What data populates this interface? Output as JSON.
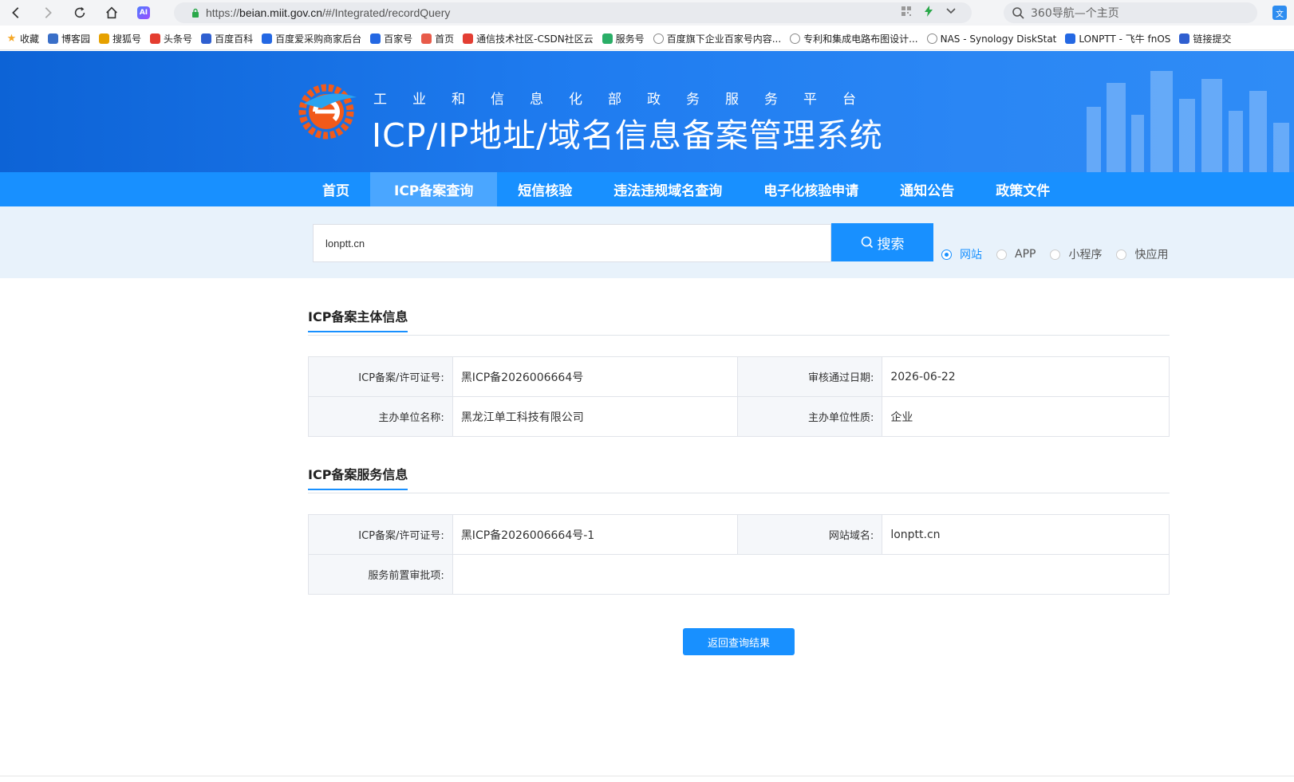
{
  "browser": {
    "url_scheme": "https://",
    "url_host": "beian.miit.gov.cn",
    "url_path": "/#/Integrated/recordQuery",
    "search_placeholder": "360导航—个主页",
    "ai_label": "AI"
  },
  "bookmarks": [
    {
      "label": "收藏",
      "icon": "star-icon",
      "color": "#f5a623"
    },
    {
      "label": "博客园",
      "icon": "cnblogs-icon",
      "color": "#3a6fc8"
    },
    {
      "label": "搜狐号",
      "icon": "sohu-icon",
      "color": "#e6a100"
    },
    {
      "label": "头条号",
      "icon": "toutiao-icon",
      "color": "#e43d30"
    },
    {
      "label": "百度百科",
      "icon": "baidu-paw-icon",
      "color": "#2f5fd0"
    },
    {
      "label": "百度爱采购商家后台",
      "icon": "caigou-icon",
      "color": "#2468e3"
    },
    {
      "label": "百家号",
      "icon": "baijiahao-icon",
      "color": "#2468e3"
    },
    {
      "label": "首页",
      "icon": "home-favicon",
      "color": "#e85b4a"
    },
    {
      "label": "通信技术社区-CSDN社区云",
      "icon": "csdn-icon",
      "color": "#e33e33"
    },
    {
      "label": "服务号",
      "icon": "wechat-icon",
      "color": "#2aae67"
    },
    {
      "label": "百度旗下企业百家号内容...",
      "icon": "globe-icon",
      "color": "#888888"
    },
    {
      "label": "专利和集成电路布图设计...",
      "icon": "globe-icon",
      "color": "#888888"
    },
    {
      "label": "NAS - Synology DiskStat",
      "icon": "globe-icon",
      "color": "#888888"
    },
    {
      "label": "LONPTT - 飞牛 fnOS",
      "icon": "fnos-icon",
      "color": "#2468e3"
    },
    {
      "label": "链接提交",
      "icon": "baidu-paw-icon",
      "color": "#2f5fd0"
    }
  ],
  "header": {
    "subtitle": "工业和信息化部政务服务平台",
    "title": "ICP/IP地址/域名信息备案管理系统"
  },
  "nav": [
    {
      "label": "首页",
      "active": false
    },
    {
      "label": "ICP备案查询",
      "active": true
    },
    {
      "label": "短信核验",
      "active": false
    },
    {
      "label": "违法违规域名查询",
      "active": false
    },
    {
      "label": "电子化核验申请",
      "active": false
    },
    {
      "label": "通知公告",
      "active": false
    },
    {
      "label": "政策文件",
      "active": false
    }
  ],
  "search": {
    "value": "lonptt.cn",
    "button_label": "搜索",
    "options": [
      {
        "label": "网站",
        "checked": true
      },
      {
        "label": "APP",
        "checked": false
      },
      {
        "label": "小程序",
        "checked": false
      },
      {
        "label": "快应用",
        "checked": false
      }
    ]
  },
  "subject_info": {
    "title": "ICP备案主体信息",
    "rows": [
      {
        "k1": "ICP备案/许可证号:",
        "v1": "黑ICP备2026006664号",
        "k2": "审核通过日期:",
        "v2": "2026-06-22"
      },
      {
        "k1": "主办单位名称:",
        "v1": "黑龙江单工科技有限公司",
        "k2": "主办单位性质:",
        "v2": "企业"
      }
    ]
  },
  "service_info": {
    "title": "ICP备案服务信息",
    "license_label": "ICP备案/许可证号:",
    "license_value": "黑ICP备2026006664号-1",
    "domain_label": "网站域名:",
    "domain_value": "lonptt.cn",
    "approval_label": "服务前置审批项:",
    "approval_value": ""
  },
  "back_button": "返回查询结果",
  "colors": {
    "primary": "#1890ff",
    "nav_active": "#4aa6ff",
    "header_dark": "#0d63d6"
  }
}
